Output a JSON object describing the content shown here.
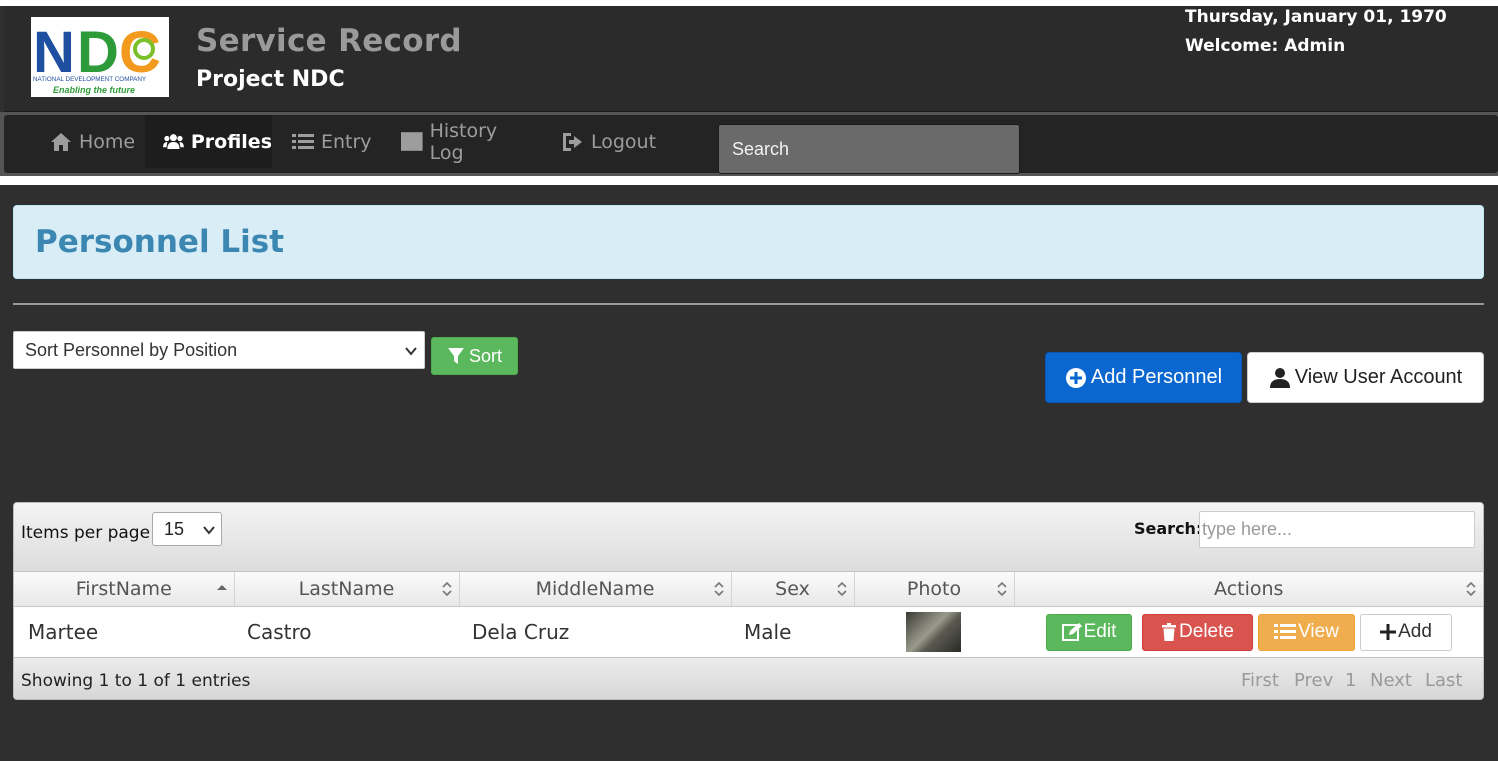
{
  "header": {
    "logo_text": "NDC",
    "logo_company": "NATIONAL DEVELOPMENT COMPANY",
    "logo_tagline": "Enabling the future",
    "app_title": "Service Record",
    "app_subtitle": "Project NDC",
    "date": "Thursday, January 01, 1970",
    "welcome": "Welcome: Admin"
  },
  "nav": {
    "items": [
      {
        "label": "Home",
        "icon": "home-icon",
        "active": false
      },
      {
        "label": "Profiles",
        "icon": "users-icon",
        "active": true
      },
      {
        "label": "Entry",
        "icon": "list-icon",
        "active": false
      },
      {
        "label": "History Log",
        "icon": "table-icon",
        "active": false
      },
      {
        "label": "Logout",
        "icon": "logout-icon",
        "active": false
      }
    ],
    "search_placeholder": "Search"
  },
  "panel": {
    "title": "Personnel List"
  },
  "toolbar": {
    "sort_select_value": "Sort Personnel by Position",
    "sort_button": "Sort",
    "add_personnel": "Add Personnel",
    "view_user_account": "View User Account"
  },
  "table": {
    "items_per_page_label": "Items per page:",
    "items_per_page_value": "15",
    "search_label": "Search:",
    "search_placeholder": "type here...",
    "columns": [
      "FirstName",
      "LastName",
      "MiddleName",
      "Sex",
      "Photo",
      "Actions"
    ],
    "rows": [
      {
        "first": "Martee",
        "last": "Castro",
        "middle": "Dela Cruz",
        "sex": "Male"
      }
    ],
    "actions": {
      "edit": "Edit",
      "delete": "Delete",
      "view": "View",
      "add": "Add"
    },
    "footer": "Showing 1 to 1 of 1 entries",
    "pager": [
      "First",
      "Prev",
      "1",
      "Next",
      "Last"
    ]
  },
  "colors": {
    "header_bg": "#2b2b2b",
    "panel_bg": "#d9edf7",
    "panel_title": "#3b87b2",
    "primary": "#0a67d0",
    "success": "#5cb85c",
    "danger": "#d9534f",
    "warning": "#f0ad4e"
  }
}
